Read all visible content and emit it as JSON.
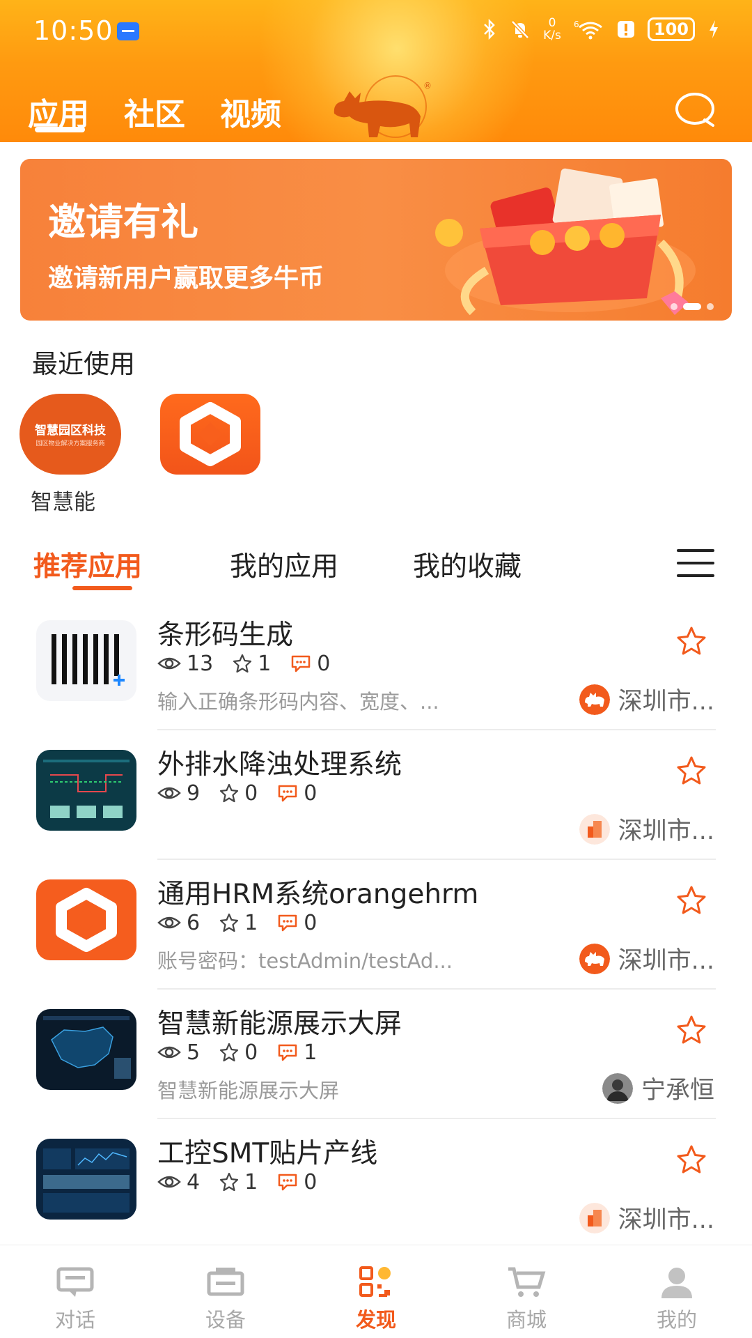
{
  "status_bar": {
    "time": "10:50",
    "net_speed_value": "0",
    "net_speed_unit": "K/s",
    "battery": "100"
  },
  "header": {
    "tabs": [
      {
        "label": "应用",
        "active": true
      },
      {
        "label": "社区",
        "active": false
      },
      {
        "label": "视频",
        "active": false
      }
    ],
    "search_icon": "search-icon",
    "logo_icon": "bull-logo"
  },
  "banner": {
    "title": "邀请有礼",
    "subtitle": "邀请新用户赢取更多牛币",
    "pages": 3,
    "active_page": 2
  },
  "recent": {
    "title": "最近使用",
    "items": [
      {
        "logo_text": "智慧园区科技",
        "logo_subtext": "园区物业解决方案服务商",
        "label": "智慧能"
      },
      {
        "logo_icon": "hexagon-app-icon",
        "label": ""
      }
    ]
  },
  "app_tabs": {
    "tabs": [
      {
        "label": "推荐应用",
        "active": true
      },
      {
        "label": "我的应用",
        "active": false
      },
      {
        "label": "我的收藏",
        "active": false
      }
    ],
    "menu_icon": "menu-icon"
  },
  "apps": [
    {
      "name": "条形码生成",
      "views": "13",
      "stars": "1",
      "comments": "0",
      "desc": "输入正确条形码内容、宽度、...",
      "author": "深圳市...",
      "author_icon": "bull-badge-icon"
    },
    {
      "name": "外排水降浊处理系统",
      "views": "9",
      "stars": "0",
      "comments": "0",
      "desc": "",
      "author": "深圳市...",
      "author_icon": "building-icon"
    },
    {
      "name": "通用HRM系统orangehrm",
      "views": "6",
      "stars": "1",
      "comments": "0",
      "desc": "账号密码：testAdmin/testAd...",
      "author": "深圳市...",
      "author_icon": "bull-badge-icon"
    },
    {
      "name": "智慧新能源展示大屏",
      "views": "5",
      "stars": "0",
      "comments": "1",
      "desc": "智慧新能源展示大屏",
      "author": "宁承恒",
      "author_icon": "user-avatar"
    },
    {
      "name": "工控SMT贴片产线",
      "views": "4",
      "stars": "1",
      "comments": "0",
      "desc": "",
      "author": "深圳市...",
      "author_icon": "building-icon"
    }
  ],
  "bottom_nav": [
    {
      "label": "对话",
      "icon": "chat-icon",
      "active": false
    },
    {
      "label": "设备",
      "icon": "device-icon",
      "active": false
    },
    {
      "label": "发现",
      "icon": "discover-icon",
      "active": true
    },
    {
      "label": "商城",
      "icon": "cart-icon",
      "active": false
    },
    {
      "label": "我的",
      "icon": "profile-icon",
      "active": false
    }
  ],
  "colors": {
    "accent": "#f25a1c",
    "header_top": "#ffb318",
    "header_bottom": "#ff8a0a",
    "inactive": "#a8a8a8"
  }
}
